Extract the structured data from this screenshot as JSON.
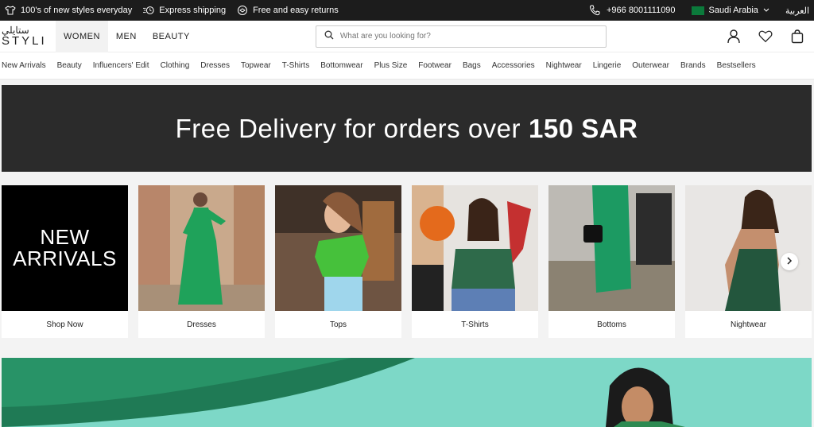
{
  "topbar": {
    "promos": [
      "100's of new styles everyday",
      "Express shipping",
      "Free and easy returns"
    ],
    "phone": "+966 8001111090",
    "country": "Saudi Arabia",
    "language": "العربية"
  },
  "header": {
    "logo_ar": "ستايلي",
    "logo_en": "STYLI",
    "tabs": [
      "WOMEN",
      "MEN",
      "BEAUTY"
    ],
    "search_placeholder": "What are you looking for?"
  },
  "categories": [
    "New Arrivals",
    "Beauty",
    "Influencers' Edit",
    "Clothing",
    "Dresses",
    "Topwear",
    "T-Shirts",
    "Bottomwear",
    "Plus Size",
    "Footwear",
    "Bags",
    "Accessories",
    "Nightwear",
    "Lingerie",
    "Outerwear",
    "Brands",
    "Bestsellers"
  ],
  "banner": {
    "text": "Free Delivery for orders over",
    "highlight": "150 SAR"
  },
  "tiles": [
    {
      "title": "NEW\nARRIVALS",
      "caption": "Shop Now"
    },
    {
      "caption": "Dresses"
    },
    {
      "caption": "Tops"
    },
    {
      "caption": "T-Shirts"
    },
    {
      "caption": "Bottoms"
    },
    {
      "caption": "Nightwear"
    }
  ],
  "colors": {
    "topbar": "#1c1c1c",
    "banner": "#2b2b2b",
    "hero": "#7dd8c7",
    "flag": "#0b7a3b"
  }
}
